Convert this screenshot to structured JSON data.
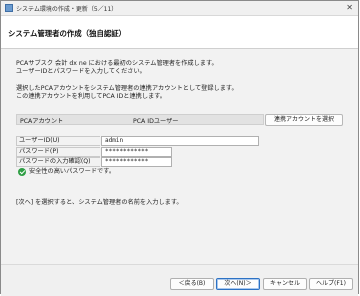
{
  "window": {
    "title": "システム環境の作成・更新（5／11）",
    "close_glyph": "✕"
  },
  "header": {
    "title": "システム管理者の作成（独自認証）"
  },
  "body": {
    "intro_line1": "PCAサブスク 会計 dx ne における最初のシステム管理者を作成します。",
    "intro_line2": "ユーザーIDとパスワードを入力してください。",
    "link_line1": "選択したPCAアカウントをシステム管理者の連携アカウントとして登録します。",
    "link_line2": "この連携アカウントを利用してPCA IDと連携します。",
    "account": {
      "label": "PCAアカウント",
      "value": "PCA IDユーザー",
      "select_button": "連携アカウントを選択"
    },
    "form": {
      "user_id_label": "ユーザーID(U)",
      "user_id_value": "admin",
      "password_label": "パスワード(P)",
      "password_value": "************",
      "confirm_label": "パスワードの入力確認(Q)",
      "confirm_value": "************"
    },
    "strength_message": "安全性の高いパスワードです。",
    "next_hint": "[次へ] を選択すると、システム管理者の名前を入力します。"
  },
  "footer": {
    "back": "＜戻る(B)",
    "next": "次へ(N)＞",
    "cancel": "キャンセル",
    "help": "ヘルプ(F1)"
  },
  "colors": {
    "success": "#2e9e44",
    "primary_border": "#2d72c4"
  }
}
